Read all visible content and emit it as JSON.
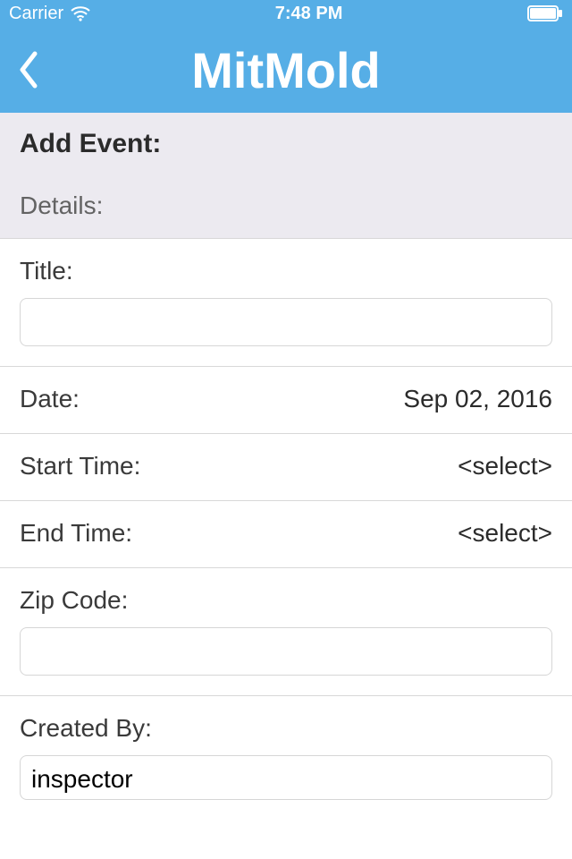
{
  "status": {
    "carrier": "Carrier",
    "time": "7:48 PM"
  },
  "header": {
    "app_title": "MitMold"
  },
  "page": {
    "heading": "Add Event:",
    "sub": "Details:"
  },
  "fields": {
    "title": {
      "label": "Title:",
      "value": ""
    },
    "date": {
      "label": "Date:",
      "value": "Sep 02, 2016"
    },
    "start": {
      "label": "Start Time:",
      "value": "<select>"
    },
    "end": {
      "label": "End Time:",
      "value": "<select>"
    },
    "zip": {
      "label": "Zip Code:",
      "value": ""
    },
    "created_by": {
      "label": "Created By:",
      "value": "inspector"
    }
  }
}
